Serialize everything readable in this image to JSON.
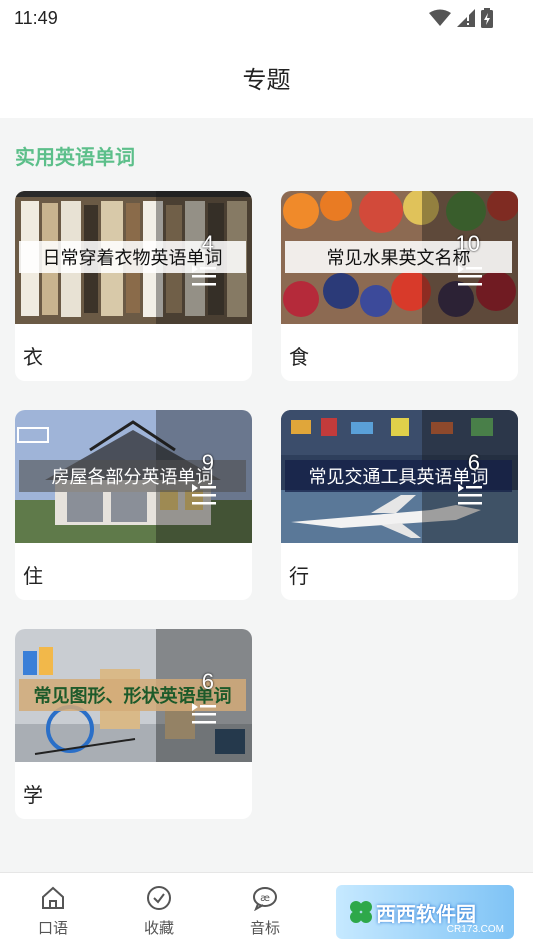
{
  "status": {
    "time": "11:49"
  },
  "header": {
    "title": "专题"
  },
  "section": {
    "title": "实用英语单词"
  },
  "cards": [
    {
      "banner": "日常穿着衣物英语单词",
      "count": "4",
      "label": "衣"
    },
    {
      "banner": "常见水果英文名称",
      "count": "10",
      "label": "食"
    },
    {
      "banner": "房屋各部分英语单词",
      "count": "9",
      "label": "住"
    },
    {
      "banner": "常见交通工具英语单词",
      "count": "6",
      "label": "行"
    },
    {
      "banner": "常见图形、形状英语单词",
      "count": "6",
      "label": "学"
    }
  ],
  "nav": [
    {
      "label": "口语",
      "icon": "home-icon"
    },
    {
      "label": "收藏",
      "icon": "check-circle-icon"
    },
    {
      "label": "音标",
      "icon": "speech-bubble-icon"
    },
    {
      "label": "",
      "icon": "user-icon"
    }
  ],
  "watermark": {
    "text": "西西软件园",
    "sub": "CR173.COM"
  }
}
